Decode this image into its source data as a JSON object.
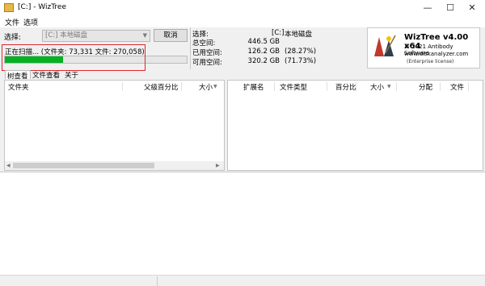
{
  "window": {
    "title": "[C:]  - WizTree",
    "minimize": "—",
    "maximize": "☐",
    "close": "✕"
  },
  "menu": {
    "file": "文件",
    "options": "选项"
  },
  "scan": {
    "select_label": "选择:",
    "drive_value": "[C:] 本地磁盘",
    "cancel_label": "取消",
    "status_text": "正在扫描... (文件夹: 73,331  文件: 270,058)",
    "progress_fraction": 0.32
  },
  "disk": {
    "select_label": "选择:",
    "select_value": "[C:]",
    "select_name": "本地磁盘",
    "total_label": "总空间:",
    "total_value": "446.5 GB",
    "used_label": "已用空间:",
    "used_value": "126.2 GB",
    "used_pct": "(28.27%)",
    "free_label": "可用空间:",
    "free_value": "320.2 GB",
    "free_pct": "(71.73%)"
  },
  "logo": {
    "title": "WizTree v4.00 x64",
    "copyright": "© 2021 Antibody Software",
    "url": "www.diskanalyzer.com",
    "license": "(Enterprise license)"
  },
  "tabs": [
    "树查看",
    "文件查看",
    "关于"
  ],
  "left_columns": [
    "文件夹",
    "父级百分比",
    "大小"
  ],
  "right_columns": [
    "扩展名",
    "文件类型",
    "百分比",
    "大小",
    "分配",
    "文件"
  ],
  "colors": {
    "progress": "#06b025",
    "highlight": "#e0262b"
  }
}
